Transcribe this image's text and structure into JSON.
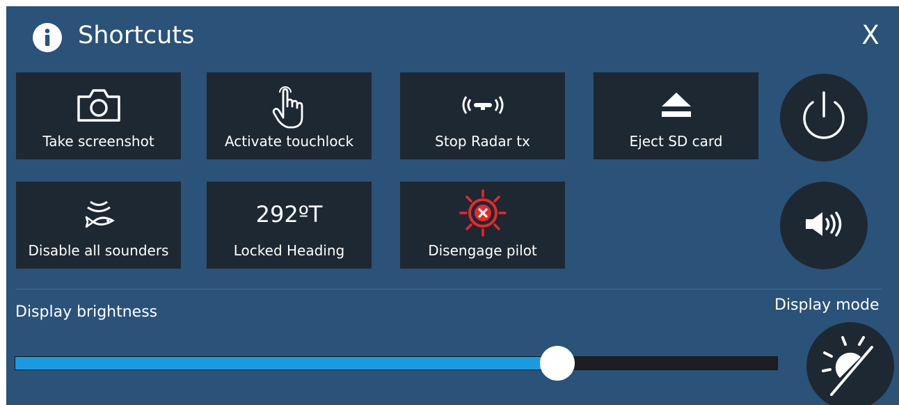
{
  "dialog": {
    "title": "Shortcuts",
    "title_icon": "info-icon",
    "close_label": "X"
  },
  "tiles": [
    {
      "label": "Take screenshot",
      "icon": "camera-icon"
    },
    {
      "label": "Activate touchlock",
      "icon": "touch-hand-icon"
    },
    {
      "label": "Stop Radar tx",
      "icon": "radar-transmit-icon"
    },
    {
      "label": "Eject SD card",
      "icon": "eject-icon"
    },
    {
      "label": "Disable all sounders",
      "icon": "sonar-fish-icon"
    },
    {
      "label": "Locked Heading",
      "value": "292ºT"
    },
    {
      "label": "Disengage pilot",
      "icon": "pilot-wheel-cancel-icon"
    }
  ],
  "side_buttons": {
    "power_icon": "power-icon",
    "volume_icon": "speaker-volume-icon"
  },
  "brightness": {
    "label": "Display brightness",
    "level": 0.711
  },
  "display_mode": {
    "label": "Display mode",
    "icon": "day-night-icon"
  },
  "colors": {
    "background": "#2b5278",
    "tile": "#1e2833",
    "slider_fill": "#1a9be0",
    "pilot_red": "#e8282a"
  }
}
